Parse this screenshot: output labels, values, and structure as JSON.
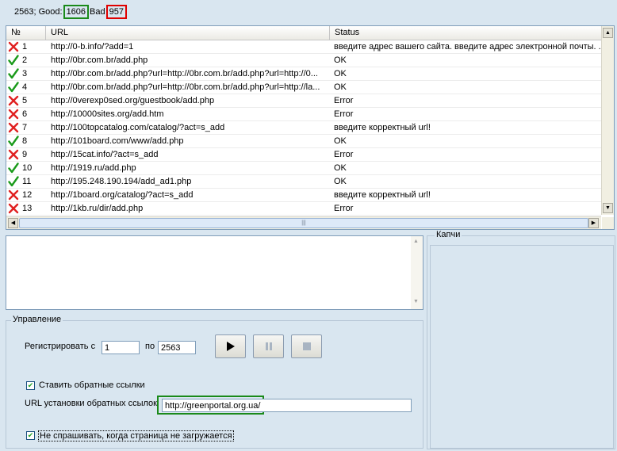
{
  "stats": {
    "total_label": "2563; Good:",
    "good": "1606",
    "bad_label": "Bad",
    "bad": "957"
  },
  "colors": {
    "ok": "#1a9a1a",
    "error": "#e02020",
    "good_box": "#1a8a1a",
    "bad_box": "#e00000"
  },
  "table": {
    "headers": [
      "№",
      "URL",
      "Status"
    ],
    "rows": [
      {
        "status_icon": "error",
        "num": "1",
        "url": "http://0-b.info/?add=1",
        "status": "введите адрес вашего сайта. введите адрес электронной почты. ..."
      },
      {
        "status_icon": "ok",
        "num": "2",
        "url": "http://0br.com.br/add.php",
        "status": "OK"
      },
      {
        "status_icon": "ok",
        "num": "3",
        "url": "http://0br.com.br/add.php?url=http://0br.com.br/add.php?url=http://0...",
        "status": "OK"
      },
      {
        "status_icon": "ok",
        "num": "4",
        "url": "http://0br.com.br/add.php?url=http://0br.com.br/add.php?url=http://la...",
        "status": "OK"
      },
      {
        "status_icon": "error",
        "num": "5",
        "url": "http://0verexp0sed.org/guestbook/add.php",
        "status": "Error"
      },
      {
        "status_icon": "error",
        "num": "6",
        "url": "http://10000sites.org/add.htm",
        "status": "Error"
      },
      {
        "status_icon": "error",
        "num": "7",
        "url": "http://100topcatalog.com/catalog/?act=s_add",
        "status": "введите корректный url!"
      },
      {
        "status_icon": "ok",
        "num": "8",
        "url": "http://101board.com/www/add.php",
        "status": "OK"
      },
      {
        "status_icon": "error",
        "num": "9",
        "url": "http://15cat.info/?act=s_add",
        "status": "Error"
      },
      {
        "status_icon": "ok",
        "num": "10",
        "url": "http://1919.ru/add.php",
        "status": "OK"
      },
      {
        "status_icon": "ok",
        "num": "11",
        "url": "http://195.248.190.194/add_ad1.php",
        "status": "OK"
      },
      {
        "status_icon": "error",
        "num": "12",
        "url": "http://1board.org/catalog/?act=s_add",
        "status": "введите корректный url!"
      },
      {
        "status_icon": "error",
        "num": "13",
        "url": "http://1kb.ru/dir/add.php",
        "status": "Error"
      }
    ]
  },
  "control": {
    "legend": "Управление",
    "register_from_label": "Регистрировать с",
    "from_value": "1",
    "to_label": "по",
    "to_value": "2563",
    "play_icon": "play-icon",
    "pause_icon": "pause-icon",
    "stop_icon": "stop-icon",
    "backlinks_label": "Ставить обратные ссылки",
    "backlinks_checked": true,
    "backlink_url_label": "URL установки обратных ссылок",
    "backlink_url_value": "http://greenportal.org.ua/",
    "dont_ask_label": "Не спрашивать, когда страница не загружается",
    "dont_ask_checked": true
  },
  "captcha": {
    "legend": "Капчи"
  }
}
